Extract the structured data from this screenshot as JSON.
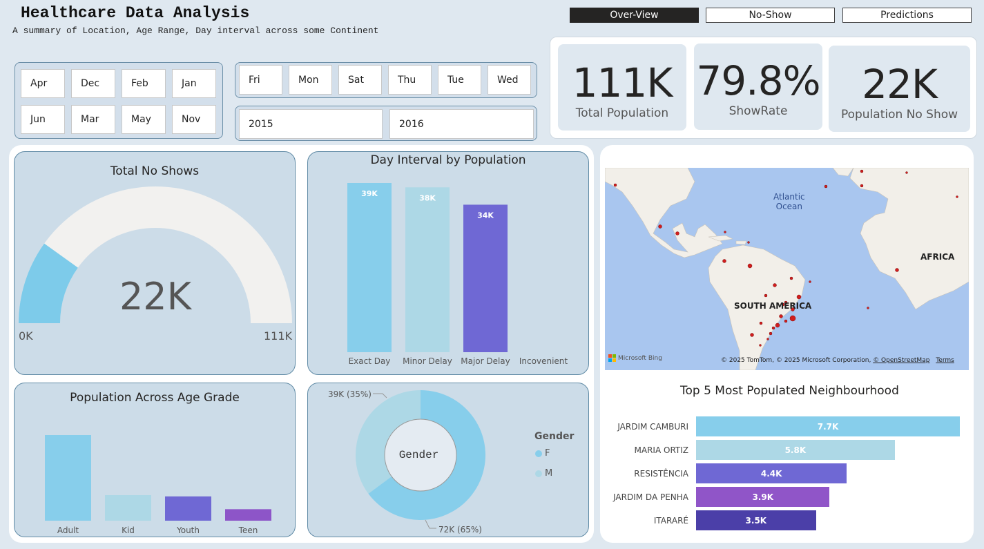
{
  "header": {
    "title": "Healthcare Data Analysis",
    "subtitle": "A summary of Location, Age Range, Day interval across some Continent"
  },
  "nav": {
    "overview": "Over-View",
    "noshow": "No-Show",
    "predictions": "Predictions"
  },
  "slicers": {
    "months": [
      "Apr",
      "Dec",
      "Feb",
      "Jan",
      "Jun",
      "Mar",
      "May",
      "Nov"
    ],
    "days": [
      "Fri",
      "Mon",
      "Sat",
      "Thu",
      "Tue",
      "Wed"
    ],
    "years": [
      "2015",
      "2016"
    ]
  },
  "kpis": {
    "total_population": {
      "value": "111K",
      "label": "Total Population"
    },
    "show_rate": {
      "value": "79.8%",
      "label": "ShowRate"
    },
    "no_show": {
      "value": "22K",
      "label": "Population No Show"
    }
  },
  "gauge": {
    "title": "Total No Shows",
    "value_label": "22K",
    "min_label": "0K",
    "max_label": "111K",
    "fraction": 0.198,
    "fill_color": "#7dcbea",
    "track_color": "#f2f1ef"
  },
  "day_interval": {
    "title": "Day Interval by Population",
    "chart_data": {
      "type": "bar",
      "categories": [
        "Exact Day",
        "Minor Delay",
        "Major Delay",
        "Incovenient"
      ],
      "values": [
        39,
        38,
        34,
        0
      ],
      "data_labels": [
        "39K",
        "38K",
        "34K",
        ""
      ],
      "colors": [
        "#87ceeb",
        "#add8e6",
        "#6f68d4",
        "#9966cc"
      ],
      "ylim": [
        0,
        39
      ]
    }
  },
  "age_grade": {
    "title": "Population Across Age Grade",
    "chart_data": {
      "type": "bar",
      "categories": [
        "Adult",
        "Kid",
        "Youth",
        "Teen"
      ],
      "values": [
        67,
        20,
        19,
        9
      ],
      "colors": [
        "#87ceeb",
        "#add8e6",
        "#6f68d4",
        "#8d55c8"
      ],
      "ylim": [
        0,
        67
      ]
    }
  },
  "gender": {
    "center_label": "Gender",
    "legend_title": "Gender",
    "chart_data": {
      "type": "pie",
      "categories": [
        "F",
        "M"
      ],
      "values": [
        72,
        39
      ],
      "labels": [
        "72K (65%)",
        "39K (35%)"
      ],
      "colors": [
        "#87ceeb",
        "#add8e6"
      ]
    }
  },
  "map": {
    "ocean_label": "Atlantic Ocean",
    "ocean_line1": "Atlantic",
    "ocean_line2": "Ocean",
    "continent_sa": "SOUTH AMERICA",
    "continent_af": "AFRICA",
    "logo": "Microsoft Bing",
    "attribution": "© 2025 TomTom, © 2025 Microsoft Corporation,",
    "osm_link": "© OpenStreetMap",
    "terms_link": "Terms"
  },
  "neighbourhoods": {
    "title": "Top 5 Most Populated Neighbourhood",
    "chart_data": {
      "type": "bar",
      "categories": [
        "JARDIM CAMBURI",
        "MARIA ORTIZ",
        "RESISTÊNCIA",
        "JARDIM DA PENHA",
        "ITARARÉ"
      ],
      "values": [
        7.7,
        5.8,
        4.4,
        3.9,
        3.5
      ],
      "data_labels": [
        "7.7K",
        "5.8K",
        "4.4K",
        "3.9K",
        "3.5K"
      ],
      "colors": [
        "#87ceeb",
        "#add8e6",
        "#6f68d4",
        "#9055c8",
        "#4b3fa8"
      ],
      "xlim": [
        0,
        7.7
      ]
    }
  }
}
